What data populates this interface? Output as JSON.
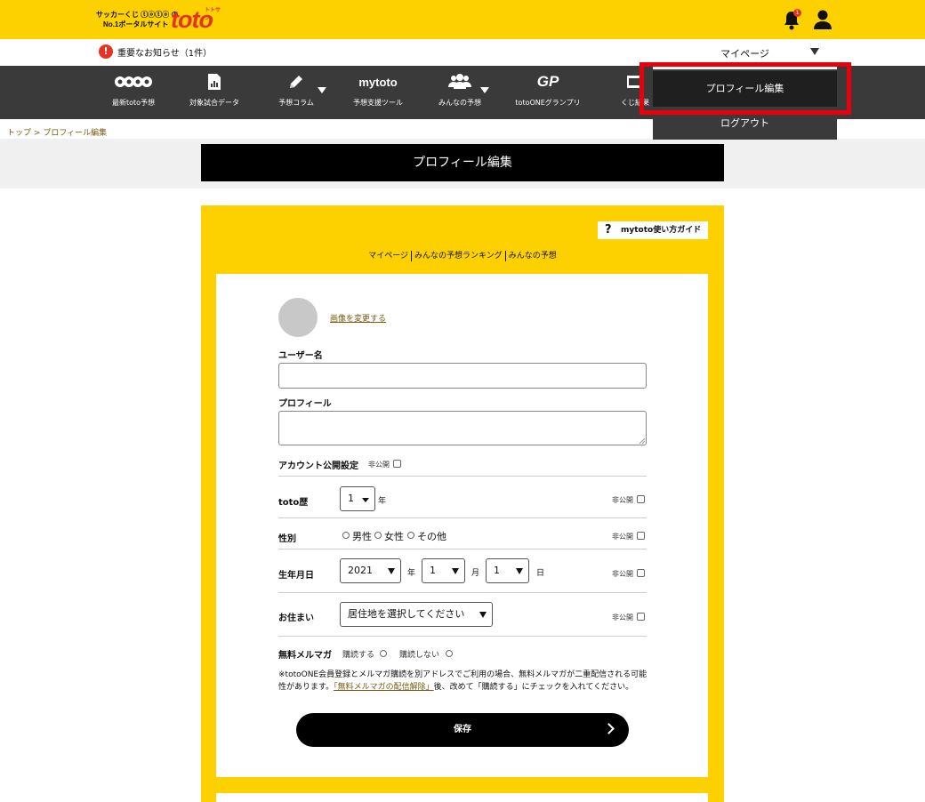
{
  "header": {
    "tagline1": "サッカーくじ ⓣⓞⓣⓞ の",
    "tagline2": "No.1ポータルサイト",
    "logo_word": "toto",
    "logo_kana": "トトサン",
    "notification_count": "1"
  },
  "notice": {
    "text": "重要なお知らせ（1件）"
  },
  "nav": {
    "items": [
      {
        "label": "最新toto予想",
        "icon": "toto-logo-icon"
      },
      {
        "label": "対象試合データ",
        "icon": "data-sheet-icon"
      },
      {
        "label": "予想コラム",
        "icon": "pencil-icon"
      },
      {
        "label": "予想支援ツール",
        "icon": "mytoto-logo-icon",
        "logo_text": "mytoto"
      },
      {
        "label": "みんなの予想",
        "icon": "people-icon"
      },
      {
        "label": "totoONEグランプリ",
        "icon": "gp-logo-icon",
        "logo_text": "GP"
      },
      {
        "label": "くじ結果",
        "icon": "lottery-icon"
      }
    ]
  },
  "breadcrumb": {
    "home": "トップ",
    "separator": ">",
    "current": "プロフィール編集"
  },
  "page": {
    "title": "プロフィール編集"
  },
  "guide": {
    "label": "mytoto使い方ガイド",
    "icon_char": "?"
  },
  "sublinks": [
    "マイページ",
    "みんなの予想ランキング",
    "みんなの予想"
  ],
  "form": {
    "change_image": "画像を変更する",
    "username_label": "ユーザー名",
    "username_value": "",
    "profile_label": "プロフィール",
    "profile_value": "",
    "account_public_label": "アカウント公開設定",
    "private_label": "非公開",
    "toto_history_label": "toto歴",
    "toto_history_value": "1",
    "toto_history_unit": "年",
    "gender_label": "性別",
    "gender_options": [
      "男性",
      "女性",
      "その他"
    ],
    "birthday_label": "生年月日",
    "birth_year": "2021",
    "birth_year_unit": "年",
    "birth_month": "1",
    "birth_month_unit": "月",
    "birth_day": "1",
    "birth_day_unit": "日",
    "address_label": "お住まい",
    "address_value": "居住地を選択してください",
    "newsletter_label": "無料メルマガ",
    "newsletter_subscribe": "購読する",
    "newsletter_unsubscribe": "購読しない",
    "note_before": "※totoONE会員登録とメルマガ購読を別アドレスでご利用の場合、無料メルマガが二重配信される可能性があります。",
    "note_link": "「無料メルマガの配信解除」",
    "note_after": "後、改めて「購読する」にチェックを入れてください。",
    "save_label": "保存"
  },
  "dropdown": {
    "mypage": "マイページ",
    "profile_edit": "プロフィール編集",
    "logout": "ログアウト"
  },
  "colors": {
    "brand_yellow": "#fdd000",
    "accent_red": "#e53323",
    "nav_dark": "#3a3a3a"
  }
}
